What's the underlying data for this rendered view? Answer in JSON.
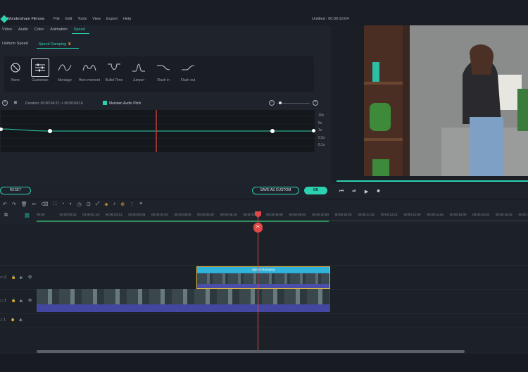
{
  "app": {
    "title": "Wondershare Filmora",
    "project_title": "Untitled : 00:00:10:04",
    "menu": [
      "File",
      "Edit",
      "Tools",
      "View",
      "Export",
      "Help"
    ]
  },
  "left_panel": {
    "tabs": [
      {
        "label": "Video",
        "active": false
      },
      {
        "label": "Audio",
        "active": false
      },
      {
        "label": "Color",
        "active": false
      },
      {
        "label": "Animation",
        "active": false
      },
      {
        "label": "Speed",
        "active": true
      }
    ],
    "subtabs": [
      {
        "label": "Uniform Speed",
        "active": false
      },
      {
        "label": "Speed Ramping",
        "active": true
      }
    ],
    "presets": [
      {
        "label": "None",
        "icon": "none-icon",
        "active": false
      },
      {
        "label": "Customize",
        "icon": "sliders-icon",
        "active": true
      },
      {
        "label": "Montage",
        "icon": "curve-montage-icon",
        "active": false
      },
      {
        "label": "Hero moment",
        "icon": "curve-hero-icon",
        "active": false
      },
      {
        "label": "Bullet Time",
        "icon": "curve-bullet-icon",
        "active": false
      },
      {
        "label": "Jumper",
        "icon": "curve-jumper-icon",
        "active": false
      },
      {
        "label": "Flash in",
        "icon": "curve-flashin-icon",
        "active": false
      },
      {
        "label": "Flash out",
        "icon": "curve-flashout-icon",
        "active": false
      }
    ],
    "duration_text": "Duration:  00:00:04:22 -> 00:00:04:16",
    "maintain_audio_pitch": {
      "label": "Maintain Audio Pitch",
      "checked": true
    },
    "speed_scale": [
      "10x",
      "5x",
      "1x",
      "0.5x",
      "0.1x"
    ],
    "reset_label": "RESET",
    "save_custom_label": "SAVE AS CUSTOM",
    "ok_label": "OK"
  },
  "preview": {
    "controls": [
      "⏮",
      "⏯",
      "▶",
      "■"
    ]
  },
  "timeline": {
    "ruler_labels": [
      "00:00",
      "00:00:00:20",
      "00:00:01:16",
      "00:00:02:12",
      "00:00:03:08",
      "00:00:04:04",
      "00:00:05:00",
      "00:00:05:20",
      "00:00:06:16",
      "00:00:07:12",
      "00:00:08:08",
      "00:00:09:04",
      "00:00:10:00",
      "00:00:10:20",
      "00:00:11:16",
      "00:00:12:12",
      "00:00:13:08",
      "00:00:14:04",
      "00:00:15:00",
      "00:00:15:20",
      "00:00:16:16",
      "00:00:17:12"
    ],
    "tracks": [
      {
        "label": "2"
      },
      {
        "label": "1"
      },
      {
        "label": "1"
      }
    ],
    "upper_clip_label": "Speed Ramping"
  },
  "colors": {
    "accent": "#2bd1b0",
    "playhead": "#e04848",
    "clip_blue": "#2aa0c8",
    "audio_wave": "#4347a0"
  }
}
